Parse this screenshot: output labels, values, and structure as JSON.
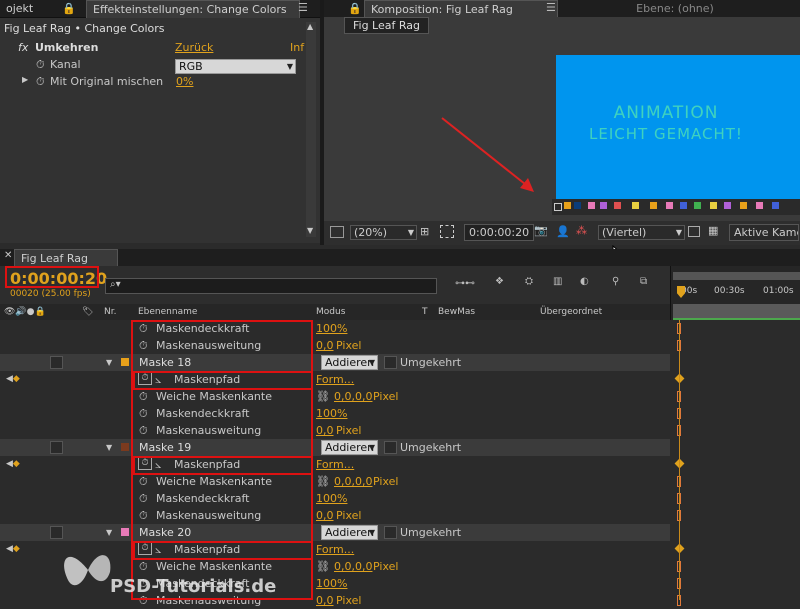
{
  "effect_panel": {
    "tab_left": "ojekt",
    "tab_title": "Effekteinstellungen: Change Colors",
    "breadcrumb": "Fig Leaf Rag • Change Colors",
    "effect_name": "Umkehren",
    "reset_label": "Zurück",
    "info_label": "Inf",
    "params": [
      {
        "label": "Kanal",
        "value": "RGB"
      },
      {
        "label": "Mit Original mischen",
        "value": "0%"
      }
    ]
  },
  "comp_panel": {
    "tab_title": "Komposition: Fig Leaf Rag",
    "tab_layer": "Ebene: (ohne)",
    "subtab": "Fig Leaf Rag",
    "preview_text_line1": "ANIMATION",
    "preview_text_line2": "LEICHT GEMACHT!",
    "preview_bg": "#0095ee",
    "preview_text_color": "#3fd2bf",
    "zoom": "(20%)",
    "timecode": "0:00:00:20",
    "resolution": "(Viertel)",
    "camera": "Aktive Kamera"
  },
  "timeline": {
    "tab_title": "Fig Leaf Rag",
    "current_time": "0:00:00:20",
    "frame_info": "00020 (25.00 fps)",
    "search_placeholder": "",
    "columns": {
      "nr": "Nr.",
      "layer_name": "Ebenenname",
      "mode": "Modus",
      "t": "T",
      "trkmat": "BewMas",
      "parent": "Übergeordnet"
    },
    "ruler": [
      "00s",
      "00:30s",
      "01:00s"
    ],
    "rows": [
      {
        "type": "prop",
        "label": "Maskendeckkraft",
        "value": "100%",
        "unit": ""
      },
      {
        "type": "prop",
        "label": "Maskenausweitung",
        "value": "0,0",
        "unit": "Pixel"
      },
      {
        "type": "mask",
        "label": "Maske 18",
        "color": "#e8a11a",
        "mode": "Addieren",
        "invert": "Umgekehrt"
      },
      {
        "type": "path",
        "label": "Maskenpfad",
        "value": "Form..."
      },
      {
        "type": "feather",
        "label": "Weiche Maskenkante",
        "value": "0,0,0,0",
        "unit": "Pixel"
      },
      {
        "type": "prop",
        "label": "Maskendeckkraft",
        "value": "100%",
        "unit": ""
      },
      {
        "type": "prop",
        "label": "Maskenausweitung",
        "value": "0,0",
        "unit": "Pixel"
      },
      {
        "type": "mask",
        "label": "Maske 19",
        "color": "#7a3a1e",
        "mode": "Addieren",
        "invert": "Umgekehrt"
      },
      {
        "type": "path",
        "label": "Maskenpfad",
        "value": "Form..."
      },
      {
        "type": "feather",
        "label": "Weiche Maskenkante",
        "value": "0,0,0,0",
        "unit": "Pixel"
      },
      {
        "type": "prop",
        "label": "Maskendeckkraft",
        "value": "100%",
        "unit": ""
      },
      {
        "type": "prop",
        "label": "Maskenausweitung",
        "value": "0,0",
        "unit": "Pixel"
      },
      {
        "type": "mask",
        "label": "Maske 20",
        "color": "#e87ab8",
        "mode": "Addieren",
        "invert": "Umgekehrt"
      },
      {
        "type": "path",
        "label": "Maskenpfad",
        "value": "Form..."
      },
      {
        "type": "feather",
        "label": "Weiche Maskenkante",
        "value": "0,0,0,0",
        "unit": "Pixel"
      },
      {
        "type": "prop",
        "label": "Maskendeckkraft",
        "value": "100%",
        "unit": ""
      },
      {
        "type": "prop",
        "label": "Maskenausweitung",
        "value": "0,0",
        "unit": "Pixel"
      }
    ]
  },
  "watermark": "PSD-Tutorials.de",
  "colors": {
    "accent": "#e0a21d",
    "highlight_box": "#dd1111",
    "arrow": "#dd2222"
  }
}
